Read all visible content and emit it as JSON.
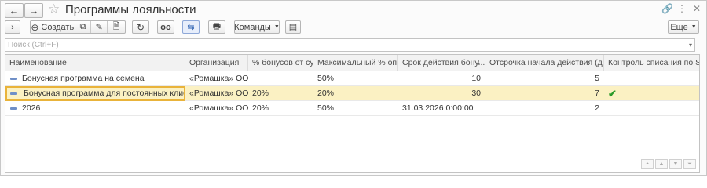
{
  "window": {
    "title": "Программы лояльности",
    "more_label": "Еще"
  },
  "toolbar": {
    "create_label": "Создать",
    "commands_label": "Команды"
  },
  "search": {
    "placeholder": "Поиск (Ctrl+F)",
    "value": ""
  },
  "table": {
    "columns": [
      "Наименование",
      "Организация",
      "% бонусов от су...",
      "Максимальный % опл...",
      "Срок действия бону...",
      "Отсрочка начала действия (дней)",
      "Контроль списания по SMS"
    ],
    "rows": [
      {
        "name": "Бонусная программа на семена",
        "org": "«Ромашка» ООО",
        "bonus_pct": "",
        "max_pct": "50%",
        "validity": "10",
        "delay": "5",
        "sms": ""
      },
      {
        "name": "Бонусная программа для постоянных клиентов",
        "org": "«Ромашка» ООО",
        "bonus_pct": "20%",
        "max_pct": "20%",
        "validity": "30",
        "delay": "7",
        "sms": "✔"
      },
      {
        "name": "2026",
        "org": "«Ромашка» ООО",
        "bonus_pct": "20%",
        "max_pct": "50%",
        "validity": "31.03.2026 0:00:00",
        "delay": "2",
        "sms": ""
      }
    ],
    "selected_row": 1,
    "sort_column": 4,
    "sort_direction": "descending"
  },
  "colors": {
    "selected_row": "#fbf1c3",
    "focus_border": "#e9b33a",
    "check": "#2a9a2a"
  }
}
